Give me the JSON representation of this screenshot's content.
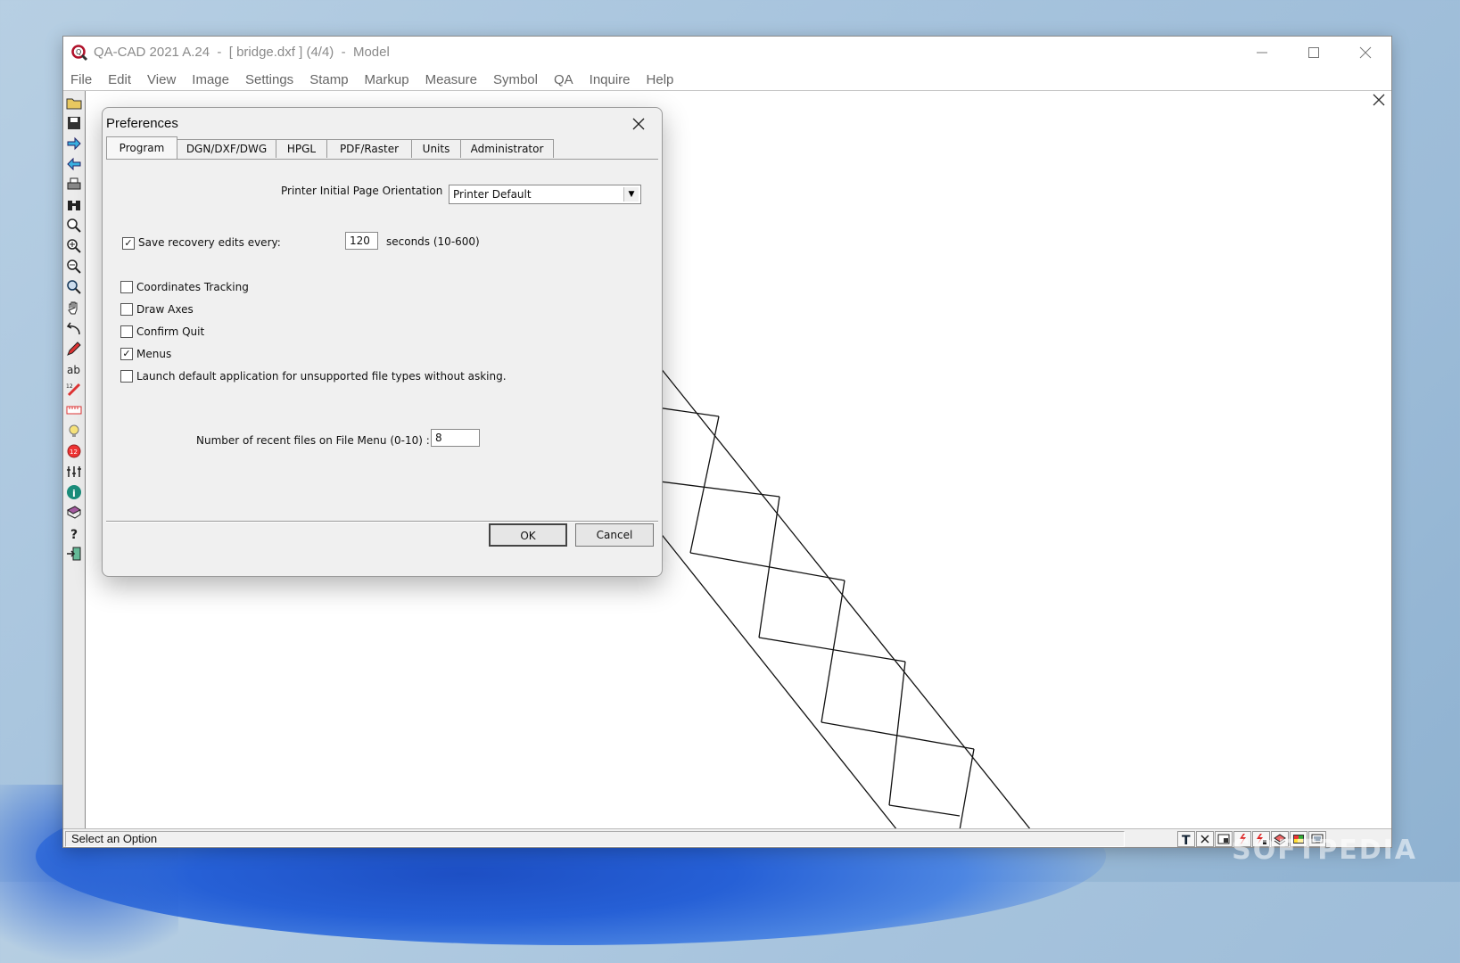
{
  "window": {
    "title": "QA-CAD 2021 A.24  -  [ bridge.dxf ] (4/4)  -  Model",
    "minimize_icon": "minimize-icon",
    "maximize_icon": "maximize-icon",
    "close_icon": "close-icon"
  },
  "menu": [
    "File",
    "Edit",
    "View",
    "Image",
    "Settings",
    "Stamp",
    "Markup",
    "Measure",
    "Symbol",
    "QA",
    "Inquire",
    "Help"
  ],
  "toolbar": {
    "icons": [
      "open-icon",
      "save-icon",
      "next-icon",
      "previous-icon",
      "print-icon",
      "binoculars-icon",
      "zoom-icon",
      "zoom-in-icon",
      "zoom-out-icon",
      "zoom-window-icon",
      "pan-hand-icon",
      "undo-icon",
      "pencil-icon",
      "text-icon",
      "measure-icon",
      "ruler-icon",
      "lightbulb-icon",
      "count-icon",
      "calculator-icon",
      "info-icon",
      "book-icon",
      "help-icon",
      "exit-icon"
    ]
  },
  "dialog": {
    "title": "Preferences",
    "tabs": [
      "Program",
      "DGN/DXF/DWG",
      "HPGL",
      "PDF/Raster",
      "Units",
      "Administrator"
    ],
    "active_tab": "Program",
    "orientation_label": "Printer Initial Page Orientation",
    "orientation_value": "Printer Default",
    "save_recovery_label": "Save recovery edits every:",
    "save_recovery_checked": true,
    "save_recovery_value": "120",
    "seconds_label": "seconds (10-600)",
    "options": [
      {
        "label": "Coordinates Tracking",
        "checked": false
      },
      {
        "label": "Draw Axes",
        "checked": false
      },
      {
        "label": "Confirm Quit",
        "checked": false
      },
      {
        "label": "Menus",
        "checked": true
      },
      {
        "label": "Launch default application for unsupported file types without asking.",
        "checked": false
      }
    ],
    "recent_files_label": "Number of recent files on File Menu (0-10) :",
    "recent_files_value": "8",
    "ok_label": "OK",
    "cancel_label": "Cancel"
  },
  "status": {
    "text": "Select an Option",
    "icons": [
      "text-tool-icon",
      "close-small-icon",
      "window-icon",
      "lightning-icon",
      "lightning-lock-icon",
      "layers-icon",
      "palette-icon",
      "display-icon"
    ]
  },
  "watermark": "SOFTPEDIA"
}
